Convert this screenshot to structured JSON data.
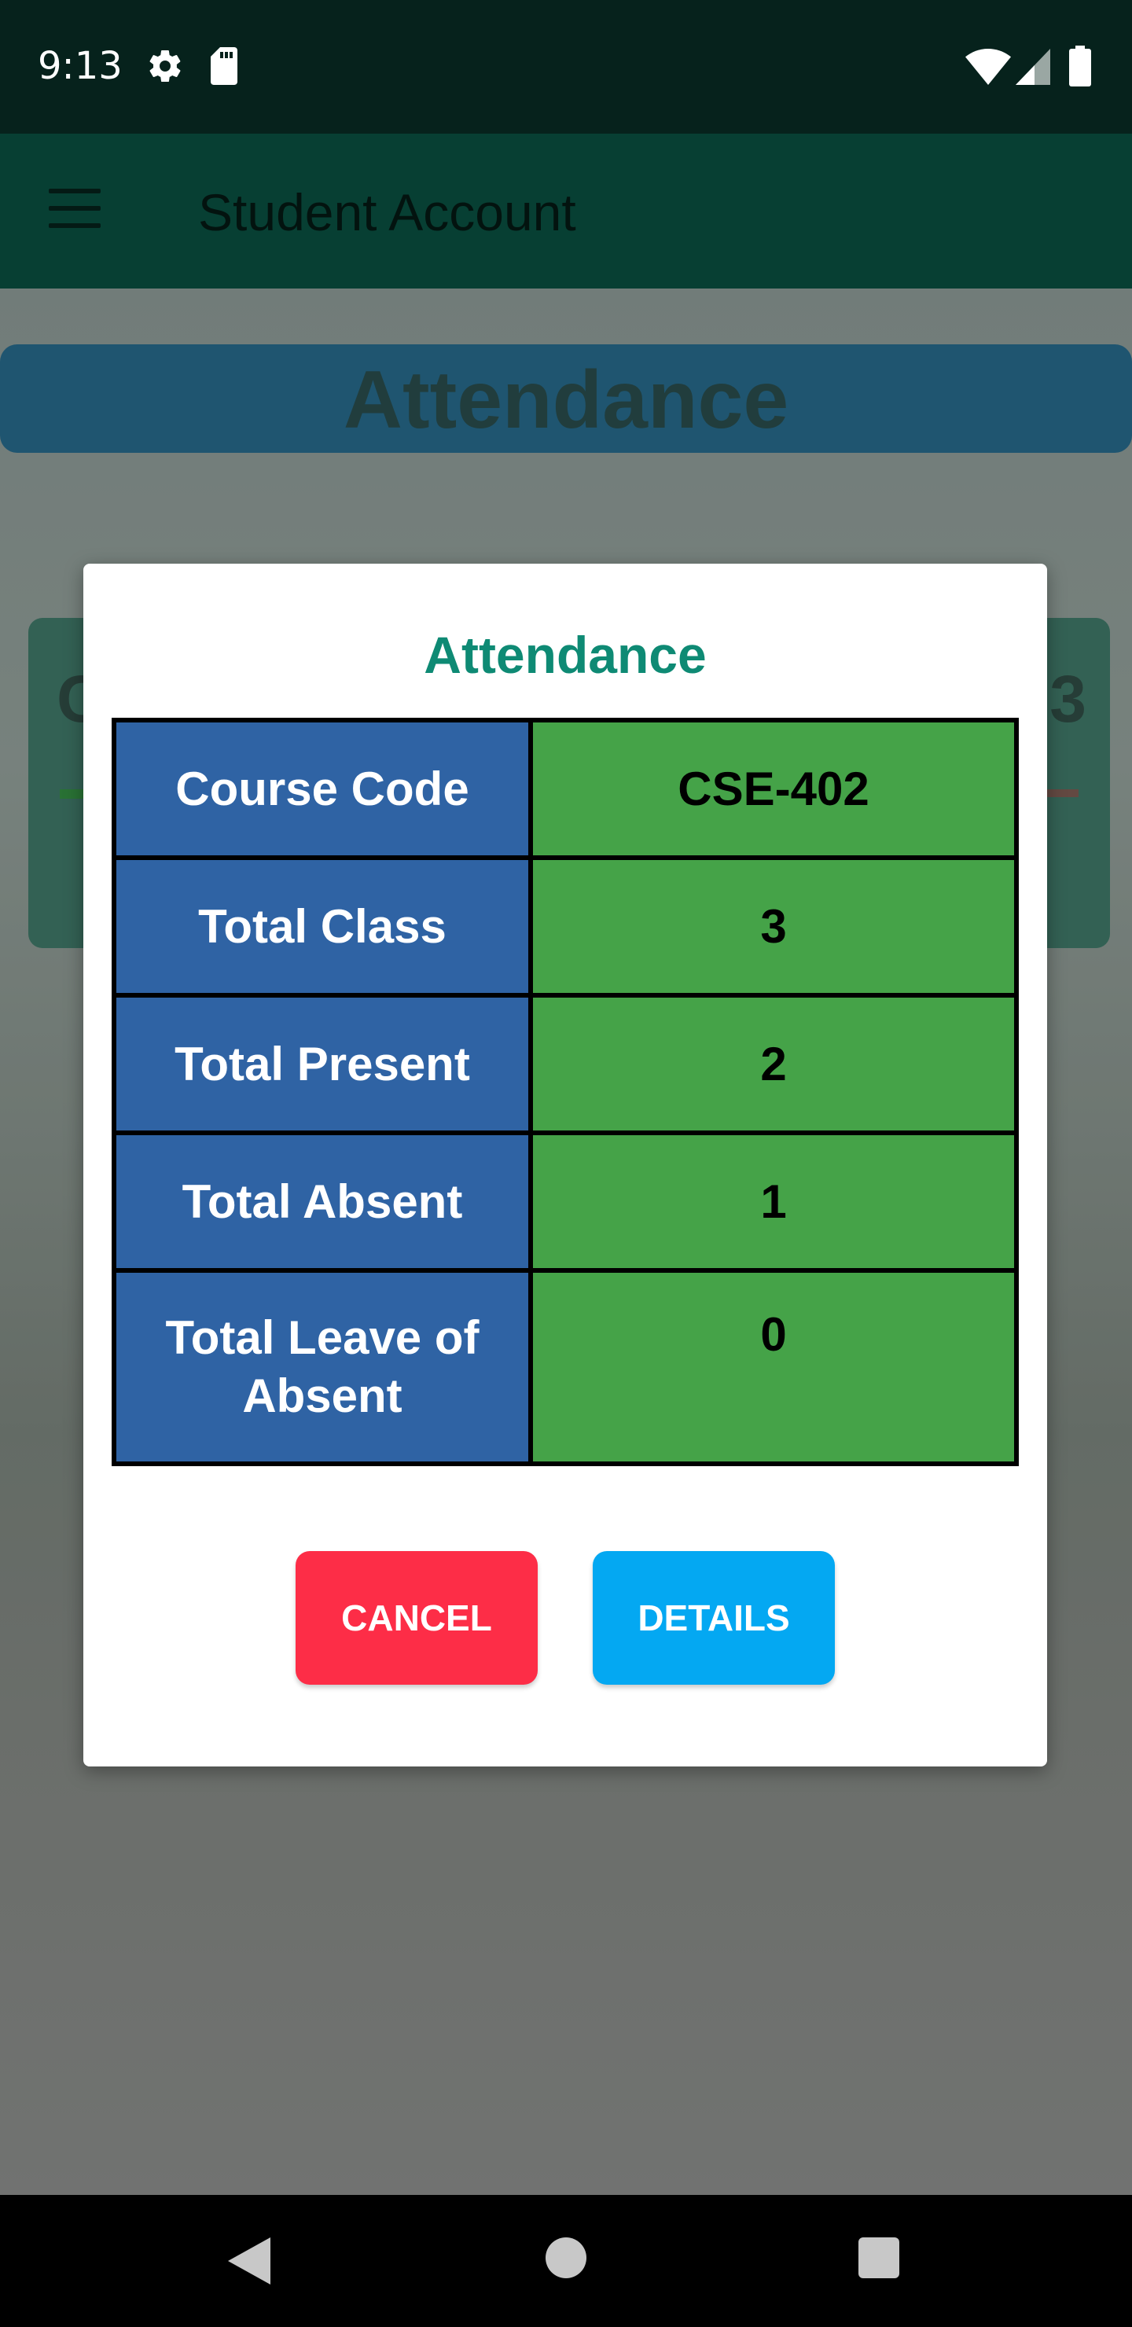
{
  "status_bar": {
    "time": "9:13",
    "icons": [
      "gear-icon",
      "sd-card-icon",
      "wifi-icon",
      "signal-icon",
      "battery-icon"
    ]
  },
  "app_bar": {
    "title": "Student Account",
    "menu_icon": "hamburger-menu-icon"
  },
  "background": {
    "header_title": "Attendance",
    "card_left_text": "C",
    "card_right_text": "3"
  },
  "dialog": {
    "title": "Attendance",
    "rows": [
      {
        "label": "Course Code",
        "value": "CSE-402"
      },
      {
        "label": "Total Class",
        "value": "3"
      },
      {
        "label": "Total Present",
        "value": "2"
      },
      {
        "label": "Total Absent",
        "value": "1"
      },
      {
        "label": "Total Leave of Absent",
        "value": "0"
      }
    ],
    "cancel_label": "CANCEL",
    "details_label": "DETAILS"
  },
  "nav_bar": {
    "icons": [
      "back-icon",
      "home-icon",
      "recents-icon"
    ]
  },
  "colors": {
    "label_cell": "#2f63a4",
    "value_cell": "#45a348",
    "cancel": "#fd2d47",
    "details": "#04a8f2",
    "dialog_title": "#0e8a74"
  }
}
